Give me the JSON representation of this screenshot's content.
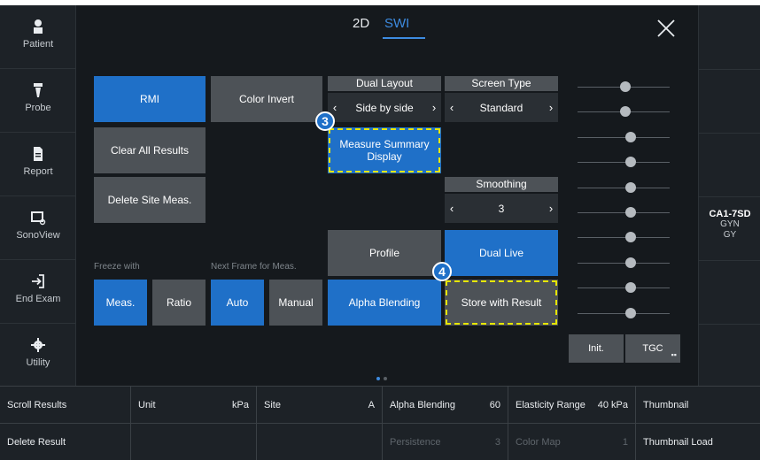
{
  "nav": [
    {
      "label": "Patient",
      "icon": "patient-icon"
    },
    {
      "label": "Probe",
      "icon": "probe-icon"
    },
    {
      "label": "Report",
      "icon": "report-icon"
    },
    {
      "label": "SonoView",
      "icon": "sonoview-icon"
    },
    {
      "label": "End Exam",
      "icon": "end-exam-icon"
    },
    {
      "label": "Utility",
      "icon": "gear-icon"
    }
  ],
  "tabs": {
    "mode_2d": "2D",
    "mode_swi": "SWI",
    "active": "SWI"
  },
  "buttons": {
    "rmi": "RMI",
    "color_invert": "Color Invert",
    "clear_all_results": "Clear All Results",
    "delete_site_meas": "Delete Site Meas.",
    "measure_summary_display": "Measure Summary\nDisplay",
    "profile": "Profile",
    "dual_live": "Dual Live",
    "alpha_blending": "Alpha Blending",
    "store_with_result": "Store with Result",
    "freeze_meas": "Meas.",
    "freeze_ratio": "Ratio",
    "next_auto": "Auto",
    "next_manual": "Manual",
    "init": "Init.",
    "tgc": "TGC"
  },
  "selectors": {
    "dual_layout": {
      "label": "Dual Layout",
      "value": "Side by side"
    },
    "screen_type": {
      "label": "Screen Type",
      "value": "Standard"
    },
    "smoothing": {
      "label": "Smoothing",
      "value": "3"
    }
  },
  "captions": {
    "freeze_with": "Freeze with",
    "next_frame": "Next Frame for Meas."
  },
  "badges": {
    "b3": "3",
    "b4": "4"
  },
  "probe": {
    "name": "CA1-7SD",
    "preset": "GYN",
    "sub": "GY"
  },
  "tgc_levels": [
    0.52,
    0.52,
    0.58,
    0.58,
    0.58,
    0.58,
    0.58,
    0.58,
    0.58,
    0.58
  ],
  "page_dots": {
    "count": 2,
    "active": 0
  },
  "bottom_grid": {
    "row1": [
      {
        "key": "Scroll Results",
        "value": ""
      },
      {
        "key": "Unit",
        "value": "kPa"
      },
      {
        "key": "Site",
        "value": "A"
      },
      {
        "key": "Alpha Blending",
        "value": "60"
      },
      {
        "key": "Elasticity Range",
        "value": "40 kPa"
      },
      {
        "key": "Thumbnail",
        "value": ""
      }
    ],
    "row2": [
      {
        "key": "Delete Result",
        "value": ""
      },
      {
        "key": "",
        "value": ""
      },
      {
        "key": "",
        "value": ""
      },
      {
        "key": "Persistence",
        "value": "3"
      },
      {
        "key": "Color Map",
        "value": "1"
      },
      {
        "key": "Thumbnail Load",
        "value": ""
      }
    ]
  },
  "colors": {
    "accent": "#1f70c8",
    "highlight_dash": "#e6e600",
    "panel": "#15191d"
  }
}
